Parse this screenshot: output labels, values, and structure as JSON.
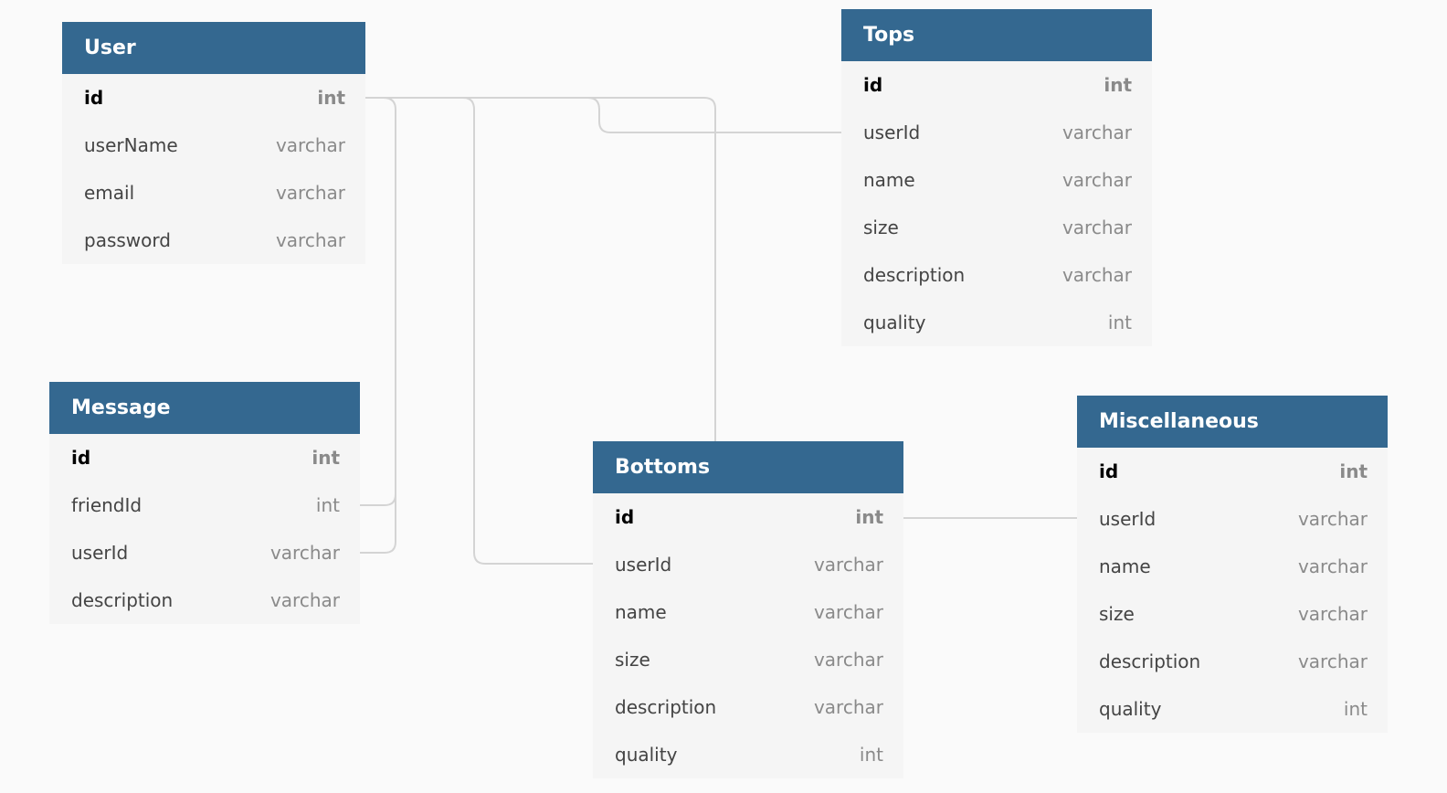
{
  "colors": {
    "header": "#346890",
    "link": "#d4d4d4",
    "background": "#fafafa"
  },
  "tables": [
    {
      "key": "user",
      "name": "User",
      "fields": [
        {
          "name": "id",
          "type": "int",
          "pk": true
        },
        {
          "name": "userName",
          "type": "varchar"
        },
        {
          "name": "email",
          "type": "varchar"
        },
        {
          "name": "password",
          "type": "varchar"
        }
      ]
    },
    {
      "key": "tops",
      "name": "Tops",
      "fields": [
        {
          "name": "id",
          "type": "int",
          "pk": true
        },
        {
          "name": "userId",
          "type": "varchar"
        },
        {
          "name": "name",
          "type": "varchar"
        },
        {
          "name": "size",
          "type": "varchar"
        },
        {
          "name": "description",
          "type": "varchar"
        },
        {
          "name": "quality",
          "type": "int"
        }
      ]
    },
    {
      "key": "message",
      "name": "Message",
      "fields": [
        {
          "name": "id",
          "type": "int",
          "pk": true
        },
        {
          "name": "friendId",
          "type": "int"
        },
        {
          "name": "userId",
          "type": "varchar"
        },
        {
          "name": "description",
          "type": "varchar"
        }
      ]
    },
    {
      "key": "bottoms",
      "name": "Bottoms",
      "fields": [
        {
          "name": "id",
          "type": "int",
          "pk": true
        },
        {
          "name": "userId",
          "type": "varchar"
        },
        {
          "name": "name",
          "type": "varchar"
        },
        {
          "name": "size",
          "type": "varchar"
        },
        {
          "name": "description",
          "type": "varchar"
        },
        {
          "name": "quality",
          "type": "int"
        }
      ]
    },
    {
      "key": "miscellaneous",
      "name": "Miscellaneous",
      "fields": [
        {
          "name": "id",
          "type": "int",
          "pk": true
        },
        {
          "name": "userId",
          "type": "varchar"
        },
        {
          "name": "name",
          "type": "varchar"
        },
        {
          "name": "size",
          "type": "varchar"
        },
        {
          "name": "description",
          "type": "varchar"
        },
        {
          "name": "quality",
          "type": "int"
        }
      ]
    }
  ],
  "relations": [
    {
      "from": "User.id",
      "to": "Bottoms.id"
    },
    {
      "from": "User.id",
      "to": "Message.friendId"
    },
    {
      "from": "User.id",
      "to": "Message.userId"
    },
    {
      "from": "User.id",
      "to": "Bottoms.userId"
    },
    {
      "from": "User.id",
      "to": "Tops.userId"
    },
    {
      "from": "Bottoms.id",
      "to": "Miscellaneous.userId"
    }
  ]
}
